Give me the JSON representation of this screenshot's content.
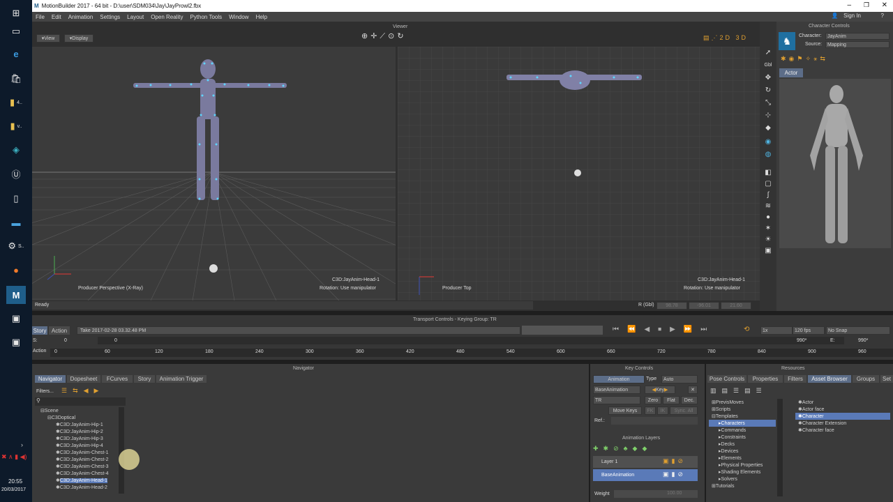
{
  "taskbar": {
    "clock_time": "20:55",
    "clock_date": "20/03/2017",
    "tiles": [
      "4..",
      "v..",
      "S.."
    ]
  },
  "window": {
    "title": "MotionBuilder 2017  -  64 bit  -  D:\\user\\SDM034\\Jay\\JayProwl2.fbx",
    "sign_in": "Sign In"
  },
  "menu": [
    "File",
    "Edit",
    "Animation",
    "Settings",
    "Layout",
    "Open Reality",
    "Python Tools",
    "Window",
    "Help"
  ],
  "viewer": {
    "title": "Viewer",
    "view_btn": "View",
    "display_btn": "Display",
    "left_label_camera": "Producer Perspective (X-Ray)",
    "left_label_model": "C3D:JayAnim-Head-1",
    "left_label_rotation": "Rotation: Use manipulator",
    "right_label_camera": "Producer Top",
    "right_label_model": "C3D:JayAnim-Head-1",
    "right_label_rotation": "Rotation: Use manipulator",
    "status": "Ready",
    "coord_label": "R (Gbl)",
    "coord_x": "98.78",
    "coord_y": "-96.01",
    "coord_z": "21.60"
  },
  "character_controls": {
    "title": "Character Controls",
    "character_label": "Character:",
    "character_value": "JayAnim",
    "source_label": "Source:",
    "source_value": "Mapping",
    "actor_tab": "Actor"
  },
  "transport": {
    "title": "Transport Controls  -  Keying Group: TR",
    "story_tab": "Story",
    "action_tab": "Action",
    "take": "Take 2017-02-28 03.32.48 PM",
    "speed": "1x",
    "fps": "120 fps",
    "snap": "No Snap",
    "start_label": "S:",
    "start_value": "0",
    "start_value2": "0",
    "end_value": "990*",
    "end_label": "E:",
    "end_value2": "990*",
    "action_label": "Action",
    "ruler": [
      "0",
      "60",
      "120",
      "180",
      "240",
      "300",
      "360",
      "420",
      "480",
      "540",
      "600",
      "660",
      "720",
      "780",
      "840",
      "900",
      "960"
    ]
  },
  "navigator": {
    "title": "Navigator",
    "tabs": [
      "Navigator",
      "Dopesheet",
      "FCurves",
      "Story",
      "Animation Trigger"
    ],
    "filters": "Filters...",
    "tree": [
      "Scene",
      "C3Doptical",
      "C3D:JayAnim-Hip-1",
      "C3D:JayAnim-Hip-2",
      "C3D:JayAnim-Hip-3",
      "C3D:JayAnim-Hip-4",
      "C3D:JayAnim-Chest-1",
      "C3D:JayAnim-Chest-2",
      "C3D:JayAnim-Chest-3",
      "C3D:JayAnim-Chest-4",
      "C3D:JayAnim-Head-1",
      "C3D:JayAnim-Head-2"
    ]
  },
  "key_controls": {
    "title": "Key Controls",
    "animation_btn": "Animation",
    "type_label": "Type",
    "type_value": "Auto",
    "layer_select": "BaseAnimation",
    "key_btn": "Key",
    "group_select": "TR",
    "zero_btn": "Zero",
    "flat_btn": "Flat",
    "dec_btn": "Dec.",
    "move_keys_btn": "Move Keys",
    "fk_btn": "FK",
    "ik_btn": "IK",
    "sync_btn": "Sync. All",
    "ref_label": "Ref.:",
    "layers_title": "Animation Layers",
    "layer1": "Layer 1",
    "base_layer": "BaseAnimation",
    "weight_label": "Weight",
    "weight_value": "100.00"
  },
  "resources": {
    "title": "Resources",
    "tabs": [
      "Pose Controls",
      "Properties",
      "Filters",
      "Asset Browser",
      "Groups",
      "Set"
    ],
    "tree": [
      "PrevisMoves",
      "Scripts",
      "Templates",
      "Characters",
      "Commands",
      "Constraints",
      "Decks",
      "Devices",
      "Elements",
      "Physical Properties",
      "Shading Elements",
      "Solvers",
      "Tutorials"
    ],
    "items": [
      "Actor",
      "Actor face",
      "Character",
      "Character Extension",
      "Character face"
    ]
  },
  "colors": {
    "accent": "#5a7ab8",
    "viewport_bg": "#3b3b3b",
    "grid": "#555555",
    "selection": "#5c6d88"
  }
}
